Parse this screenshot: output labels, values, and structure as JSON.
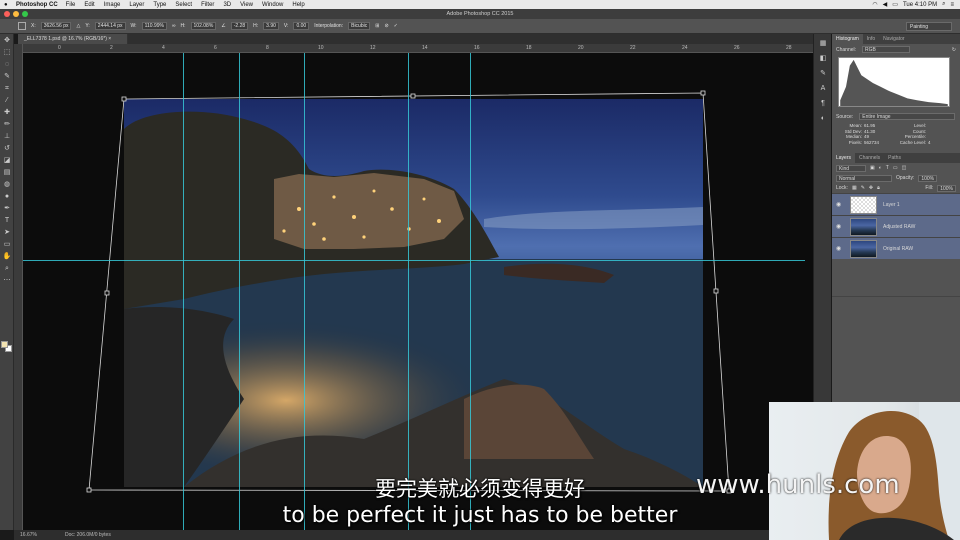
{
  "menubar": {
    "apple": "",
    "app_name": "Photoshop CC",
    "items": [
      "File",
      "Edit",
      "Image",
      "Layer",
      "Type",
      "Select",
      "Filter",
      "3D",
      "View",
      "Window",
      "Help"
    ],
    "clock": "Tue 4:10 PM"
  },
  "window": {
    "title": "Adobe Photoshop CC 2015"
  },
  "options": {
    "x_label": "X:",
    "x_value": "3626.56 px",
    "y_label": "Y:",
    "y_value": "2444.14 px",
    "w_label": "W:",
    "w_value": "110.99%",
    "h_label": "H:",
    "h_value": "102.08%",
    "angle_value": "-2.28",
    "hskew_label": "H:",
    "hskew_value": "3.90",
    "vskew_label": "V:",
    "vskew_value": "0.00",
    "interp_label": "Interpolation:",
    "interp_value": "Bicubic",
    "workspace": "Painting"
  },
  "document": {
    "tab_title": "_ELL7378 1.psd @ 16.7% (RGB/16*) ×",
    "zoom": "16.67%",
    "doc_size": "Doc: 206.0M/0 bytes"
  },
  "ruler": {
    "ticks": [
      "0",
      "2",
      "4",
      "6",
      "8",
      "10",
      "12",
      "14",
      "16",
      "18",
      "20",
      "22",
      "24",
      "26",
      "28"
    ]
  },
  "panels": {
    "histogram_tabs": [
      "Histogram",
      "Info",
      "Navigator"
    ],
    "channel_label": "Channel:",
    "channel_value": "RGB",
    "source_label": "Source:",
    "source_value": "Entire Image",
    "stats": [
      [
        "Mean:",
        "61.95",
        "Level:",
        ""
      ],
      [
        "Std Dev:",
        "41.30",
        "Count:",
        ""
      ],
      [
        "Median:",
        "49",
        "Percentile:",
        ""
      ],
      [
        "Pixels:",
        "562734",
        "Cache Level:",
        "4"
      ]
    ],
    "layer_tabs": [
      "Layers",
      "Channels",
      "Paths"
    ],
    "kind_label": "Kind",
    "blend_mode": "Normal",
    "opacity_label": "Opacity:",
    "opacity_value": "100%",
    "lock_label": "Lock:",
    "fill_label": "Fill:",
    "fill_value": "100%",
    "layers": [
      {
        "name": "Layer 1",
        "selected": true,
        "thumb": "transparent"
      },
      {
        "name": "Adjusted RAW",
        "selected": true,
        "thumb": "photo"
      },
      {
        "name": "Original RAW",
        "selected": true,
        "thumb": "photo"
      }
    ]
  },
  "overlay": {
    "caption_zh": "要完美就必须变得更好",
    "caption_en": "to be perfect it just has to be better",
    "watermark": "www.hunls.com"
  },
  "colors": {
    "guide": "#36c7d6",
    "ps_panel": "#535353",
    "layer_selected": "#5d6a8a"
  }
}
